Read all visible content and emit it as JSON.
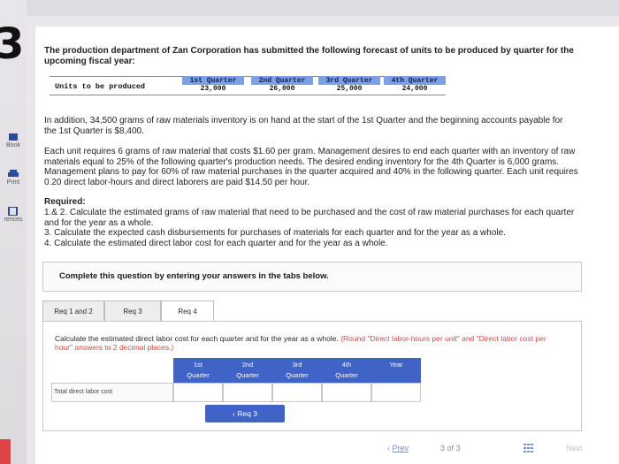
{
  "problem_number": "3",
  "rail": [
    {
      "label": "Book"
    },
    {
      "label": "Print"
    },
    {
      "label": "rences"
    }
  ],
  "intro": "The production department of Zan Corporation has submitted the following forecast of units to be produced by quarter for the upcoming fiscal year:",
  "units_table": {
    "row_label": "Units to be produced",
    "quarters": [
      {
        "label": "1st Quarter",
        "value": "23,000"
      },
      {
        "label": "2nd Quarter",
        "value": "26,000"
      },
      {
        "label": "3rd Quarter",
        "value": "25,000"
      },
      {
        "label": "4th Quarter",
        "value": "24,000"
      }
    ]
  },
  "addition": "In addition, 34,500 grams of raw materials inventory is on hand at the start of the 1st Quarter and the beginning accounts payable for the 1st Quarter is $8,400.",
  "details": "Each unit requires 6 grams of raw material that costs $1.60 per gram. Management desires to end each quarter with an inventory of raw materials equal to 25% of the following quarter's production needs. The desired ending inventory for the 4th Quarter is 6,000 grams. Management plans to pay for 60% of raw material purchases in the quarter acquired and 40% in the following quarter. Each unit requires 0.20 direct labor-hours and direct laborers are paid $14.50 per hour.",
  "required": {
    "heading": "Required:",
    "items": [
      "1.& 2. Calculate the estimated grams of raw material that need to be purchased and the cost of raw material purchases for each quarter and for the year as a whole.",
      "3. Calculate the expected cash disbursements for purchases of materials for each quarter and for the year as a whole.",
      "4. Calculate the estimated direct labor cost for each quarter and for the year as a whole."
    ]
  },
  "complete_text": "Complete this question by entering your answers in the tabs below.",
  "tabs": [
    {
      "label": "Req 1 and 2",
      "active": false
    },
    {
      "label": "Req 3",
      "active": false
    },
    {
      "label": "Req 4",
      "active": true
    }
  ],
  "panel": {
    "instruction": "Calculate the estimated direct labor cost for each quarter and for the year as a whole.",
    "note": "(Round \"Direct labor-hours per unit\" and \"Direct labor cost per hour\" answers to 2 decimal places.)"
  },
  "answer_grid": {
    "headers": [
      {
        "line1": "1st",
        "line2": "Quarter"
      },
      {
        "line1": "2nd",
        "line2": "Quarter"
      },
      {
        "line1": "3rd",
        "line2": "Quarter"
      },
      {
        "line1": "4th",
        "line2": "Quarter"
      },
      {
        "line1": "",
        "line2": "Year"
      }
    ],
    "row_label": "Total direct labor cost"
  },
  "back_button": "Req 3",
  "footer": {
    "prev": "Prev",
    "page_current": "3",
    "page_of": "of",
    "page_total": "3",
    "next": "Next"
  },
  "colors": {
    "accent": "#3f63c6",
    "quarter_header": "#7aa0e6",
    "note_red": "#d34b4b"
  }
}
